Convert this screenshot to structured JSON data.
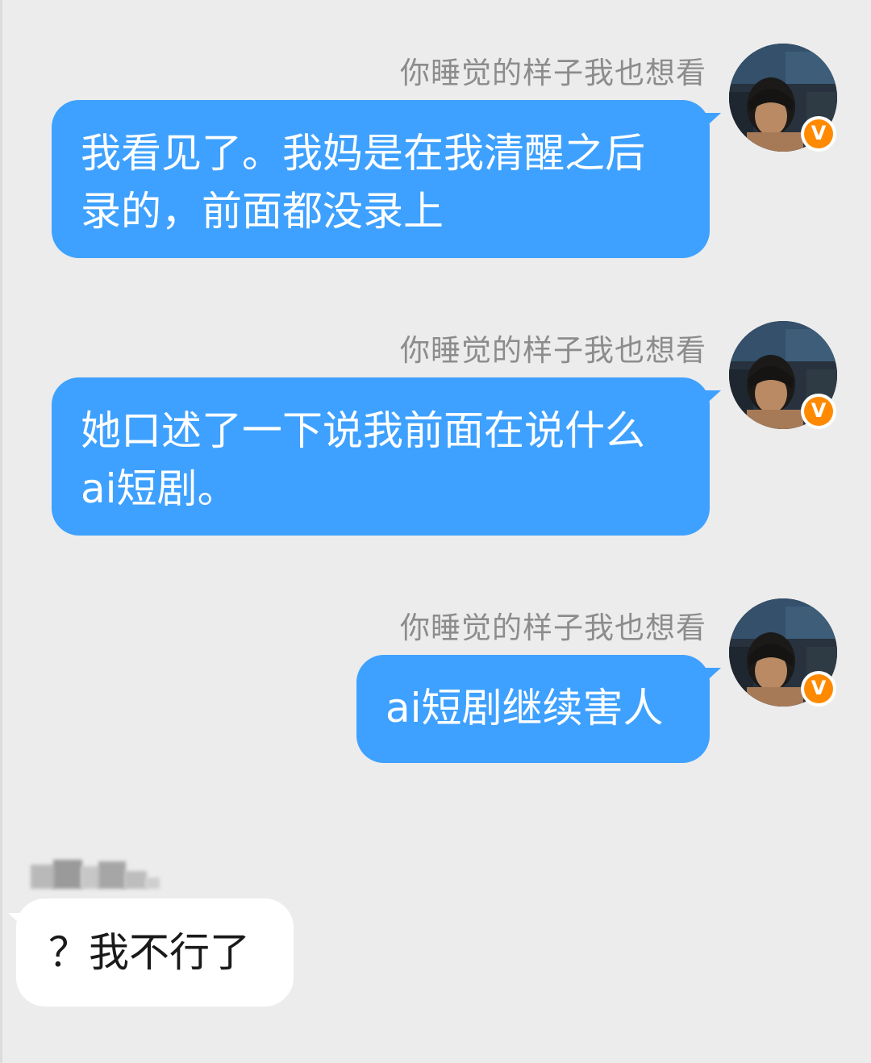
{
  "conversation": {
    "outgoing": [
      {
        "sender": "你睡觉的样子我也想看",
        "lines": [
          "我看见了。我妈是在我清醒之后",
          "录的，前面都没录上"
        ],
        "verified_badge": "V"
      },
      {
        "sender": "你睡觉的样子我也想看",
        "lines": [
          "她口述了一下说我前面在说什么",
          "ai短剧。"
        ],
        "verified_badge": "V"
      },
      {
        "sender": "你睡觉的样子我也想看",
        "lines": [
          "ai短剧继续害人"
        ],
        "verified_badge": "V"
      }
    ],
    "incoming": [
      {
        "text": "？我不行了"
      }
    ]
  },
  "colors": {
    "background": "#ececec",
    "outgoing_bubble": "#3ea1ff",
    "incoming_bubble": "#ffffff",
    "sender_name": "#8c8c8c",
    "badge": "#ff8a00"
  },
  "icons": {
    "avatar": "user-avatar-photo",
    "badge": "verified-v-badge-icon"
  }
}
